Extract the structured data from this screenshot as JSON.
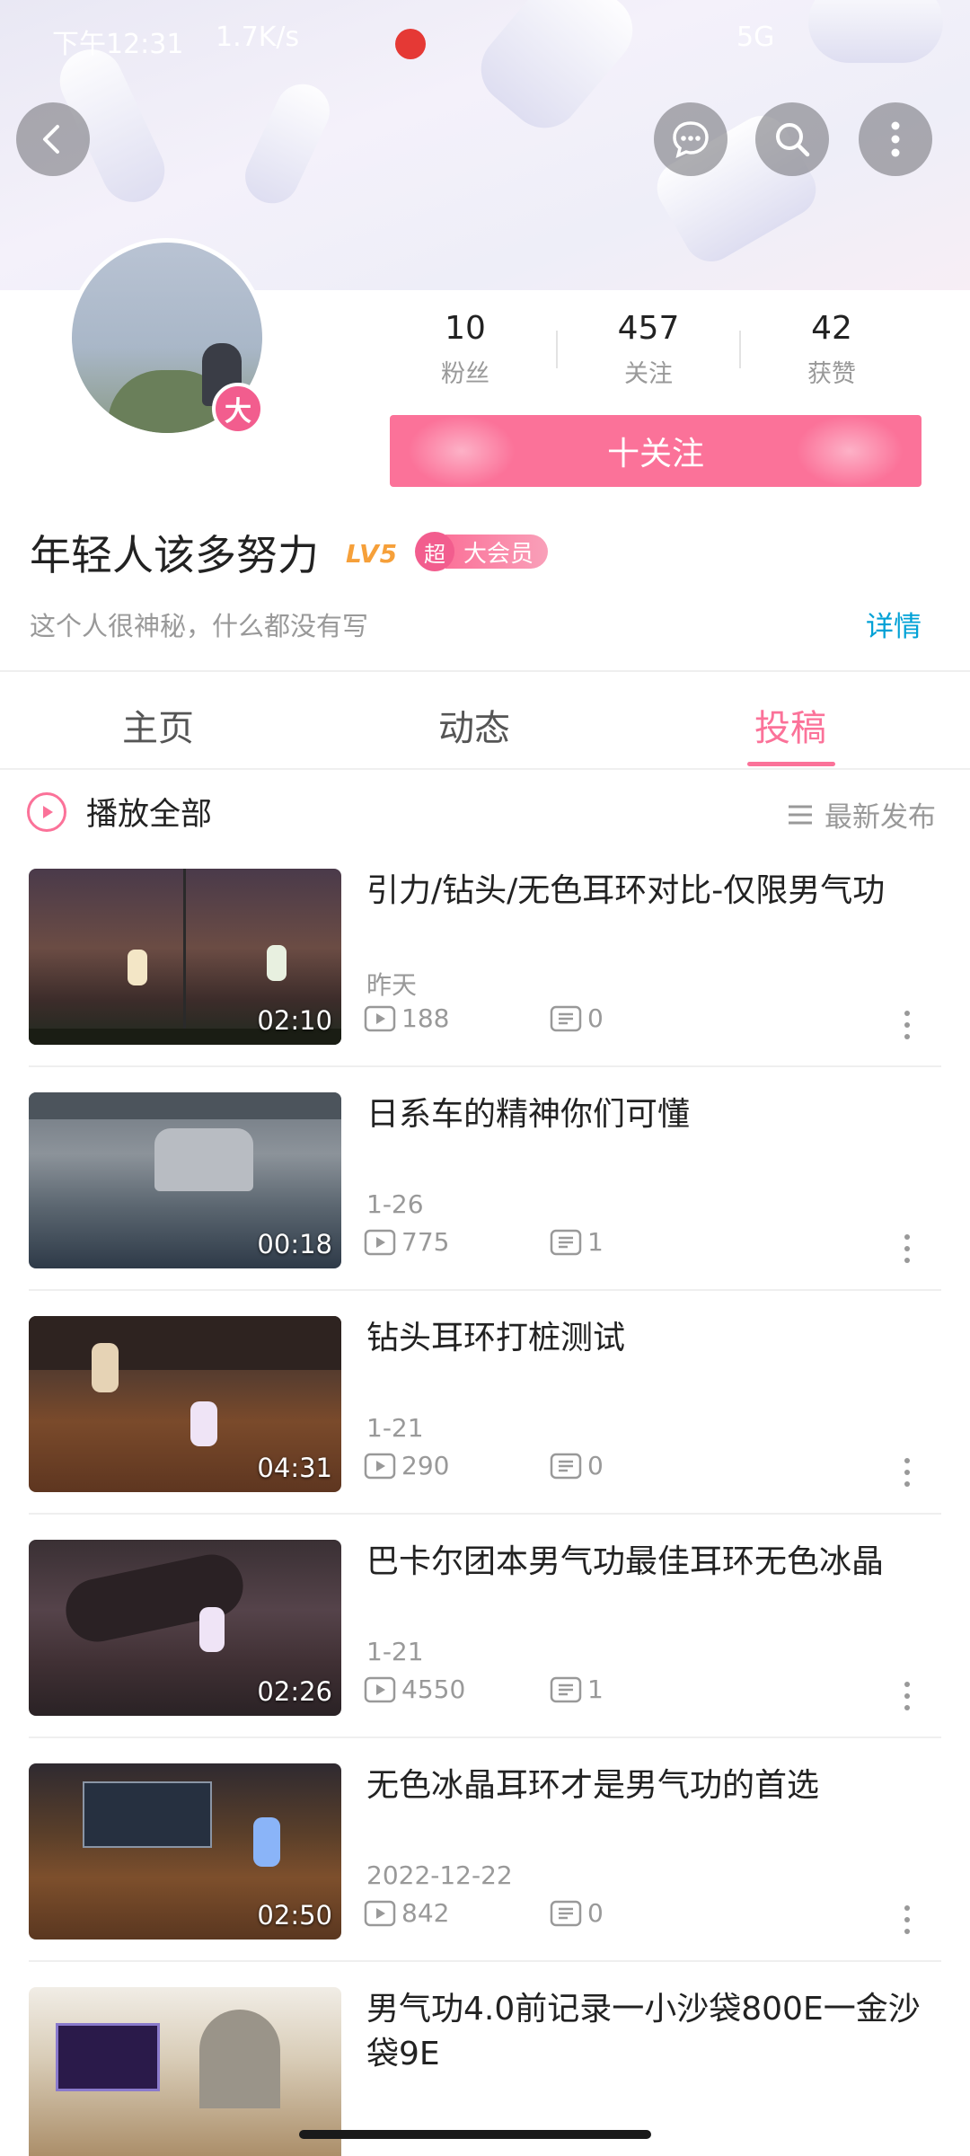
{
  "status_bar": {
    "time": "下午12:31",
    "speed": "1.7K/s",
    "network": "5G"
  },
  "header": {
    "back_icon": "back-arrow-icon",
    "message_icon": "message-icon",
    "search_icon": "search-icon",
    "more_icon": "more-vertical-icon"
  },
  "profile": {
    "avatar_badge": "大",
    "stats": [
      {
        "value": "10",
        "label": "粉丝"
      },
      {
        "value": "457",
        "label": "关注"
      },
      {
        "value": "42",
        "label": "获赞"
      }
    ],
    "follow_label": "十关注",
    "name": "年轻人该多努力",
    "level": "LV5",
    "vip_icon": "超",
    "vip_text": "大会员",
    "signature": "这个人很神秘，什么都没有写",
    "detail_link": "详情"
  },
  "tabs": [
    {
      "label": "主页",
      "active": false
    },
    {
      "label": "动态",
      "active": false
    },
    {
      "label": "投稿",
      "active": true
    }
  ],
  "list_header": {
    "play_all": "播放全部",
    "sort": "最新发布"
  },
  "videos": [
    {
      "title": "引力/钻头/无色耳环对比-仅限男气功",
      "date": "昨天",
      "duration": "02:10",
      "views": "188",
      "comments": "0"
    },
    {
      "title": "日系车的精神你们可懂",
      "date": "1-26",
      "duration": "00:18",
      "views": "775",
      "comments": "1"
    },
    {
      "title": "钻头耳环打桩测试",
      "date": "1-21",
      "duration": "04:31",
      "views": "290",
      "comments": "0"
    },
    {
      "title": "巴卡尔团本男气功最佳耳环无色冰晶",
      "date": "1-21",
      "duration": "02:26",
      "views": "4550",
      "comments": "1"
    },
    {
      "title": "无色冰晶耳环才是男气功的首选",
      "date": "2022-12-22",
      "duration": "02:50",
      "views": "842",
      "comments": "0"
    },
    {
      "title": "男气功4.0前记录一小沙袋800E一金沙袋9E",
      "date": "",
      "duration": "",
      "views": "",
      "comments": ""
    }
  ],
  "colors": {
    "accent": "#fb7299",
    "link": "#00a1d6",
    "level": "#f6a03a"
  }
}
